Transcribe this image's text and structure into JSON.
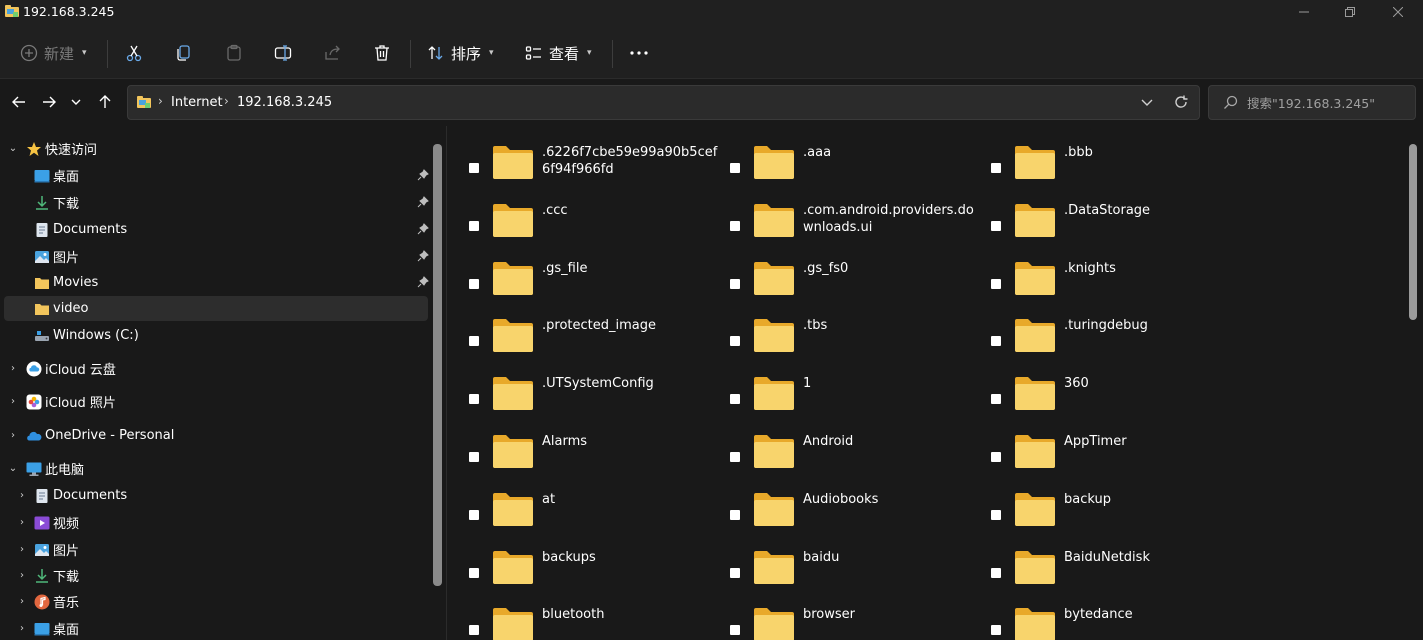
{
  "window": {
    "title": "192.168.3.245"
  },
  "toolbar": {
    "new_label": "新建",
    "sort_label": "排序",
    "view_label": "查看"
  },
  "address": {
    "crumbs": [
      "Internet",
      "192.168.3.245"
    ]
  },
  "search": {
    "placeholder": "搜索\"192.168.3.245\""
  },
  "sidebar": {
    "quick_access": "快速访问",
    "quick_items": [
      "桌面",
      "下载",
      "Documents",
      "图片",
      "Movies",
      "video",
      "Windows (C:)"
    ],
    "icloud_drive": "iCloud 云盘",
    "icloud_photos": "iCloud 照片",
    "onedrive": "OneDrive - Personal",
    "this_pc": "此电脑",
    "pc_items": [
      "Documents",
      "视频",
      "图片",
      "下载",
      "音乐",
      "桌面"
    ]
  },
  "folders": [
    ".6226f7cbe59e99a90b5cef6f94f966fd",
    ".aaa",
    ".bbb",
    ".ccc",
    ".com.android.providers.downloads.ui",
    ".DataStorage",
    ".gs_file",
    ".gs_fs0",
    ".knights",
    ".protected_image",
    ".tbs",
    ".turingdebug",
    ".UTSystemConfig",
    "1",
    "360",
    "Alarms",
    "Android",
    "AppTimer",
    "at",
    "Audiobooks",
    "backup",
    "backups",
    "baidu",
    "BaiduNetdisk",
    "bluetooth",
    "browser",
    "bytedance"
  ]
}
